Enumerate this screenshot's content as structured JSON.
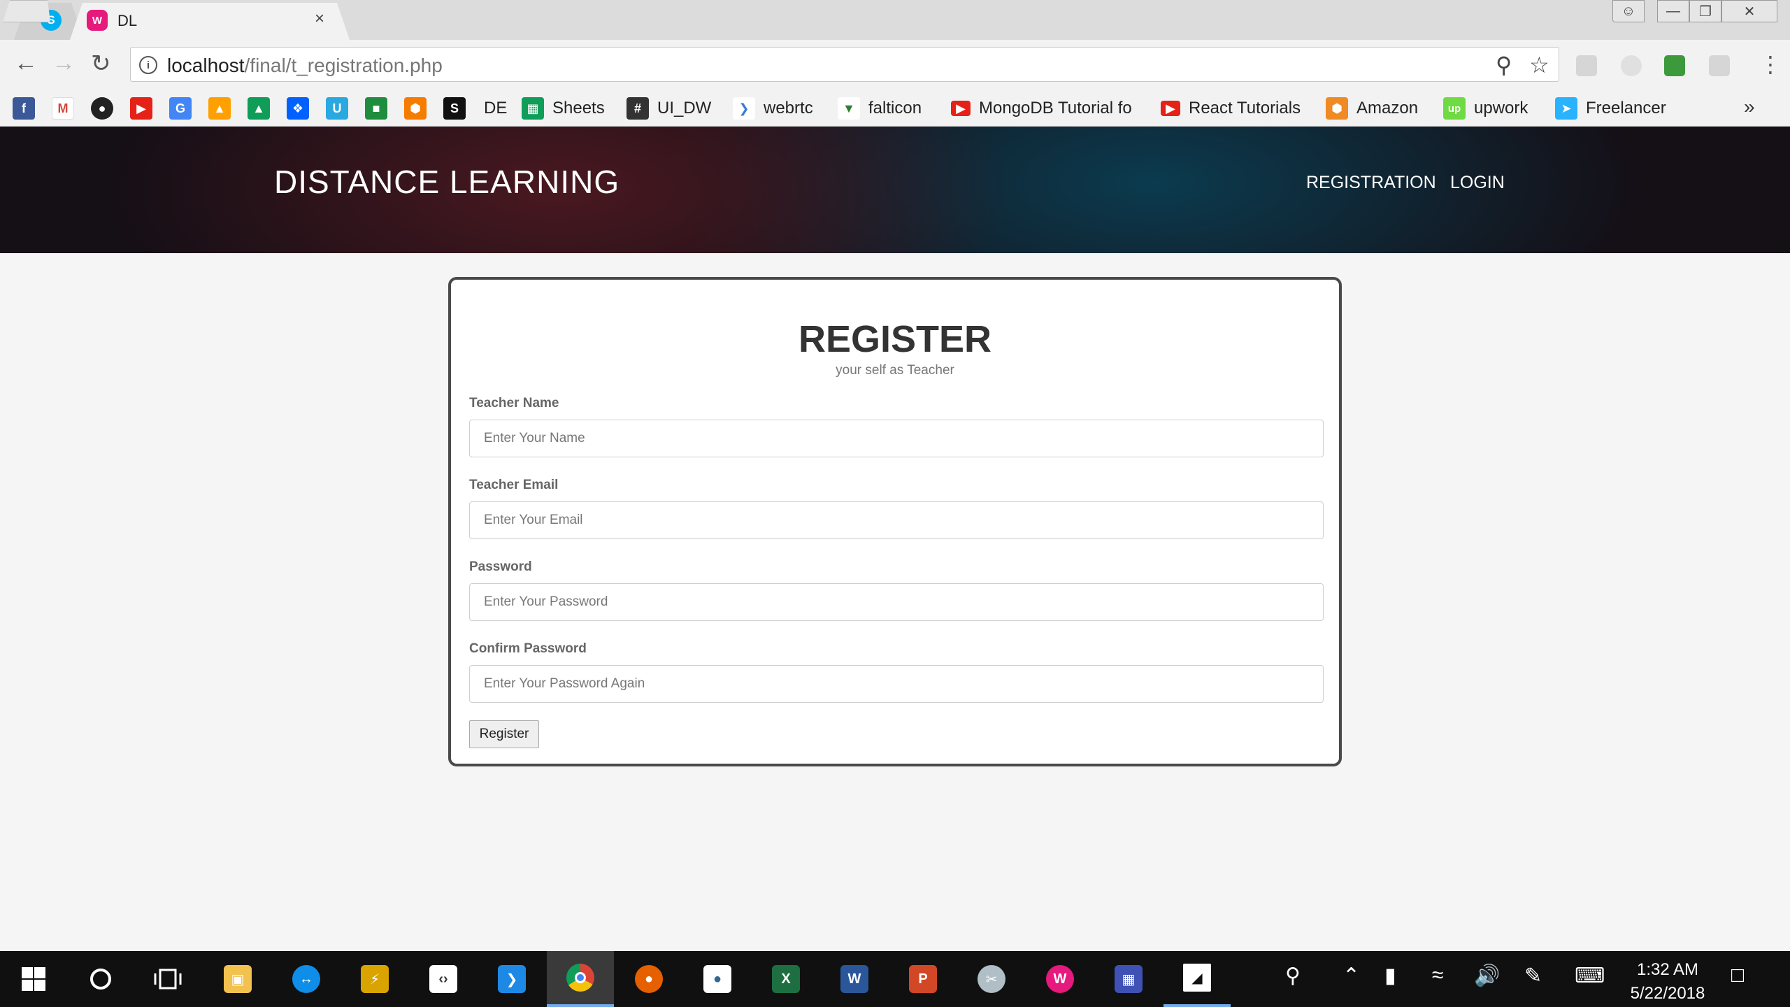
{
  "browser": {
    "tab_title": "DL",
    "tab_close": "×",
    "url_host": "localhost",
    "url_path": "/final/t_registration.php",
    "bookmarks": [
      "DE",
      "Sheets",
      "UI_DW",
      "webrtc",
      "falticon",
      "MongoDB Tutorial fo",
      "React Tutorials",
      "Amazon",
      "upwork",
      "Freelancer"
    ],
    "bookmarks_more": "»"
  },
  "site": {
    "brand": "DISTANCE LEARNING",
    "nav": {
      "registration": "REGISTRATION",
      "login": "LOGIN"
    }
  },
  "form": {
    "title": "REGISTER",
    "subtitle": "your self as Teacher",
    "fields": [
      {
        "label": "Teacher Name",
        "placeholder": "Enter Your Name",
        "value": ""
      },
      {
        "label": "Teacher Email",
        "placeholder": "Enter Your Email",
        "value": ""
      },
      {
        "label": "Password",
        "placeholder": "Enter Your Password",
        "value": ""
      },
      {
        "label": "Confirm Password",
        "placeholder": "Enter Your Password Again",
        "value": ""
      }
    ],
    "submit": "Register"
  },
  "taskbar": {
    "time": "1:32 AM",
    "date": "5/22/2018"
  },
  "icons": {
    "tabs": [
      "skype-icon",
      "wamp-icon"
    ],
    "toolbar": [
      "back-icon",
      "forward-icon",
      "reload-icon",
      "info-icon",
      "zoom-icon",
      "star-icon",
      "menu-icon"
    ],
    "taskbar": [
      "windows-icon",
      "cortana-icon",
      "task-view-icon",
      "file-explorer-icon",
      "teamviewer-icon",
      "chrome-icon",
      "vscode-icon",
      "excel-icon",
      "word-icon",
      "powerpoint-icon"
    ]
  },
  "colors": {
    "header_bg": "#150f16",
    "card_border": "#4a4a4a",
    "taskbar_accent": "#76a9ea"
  }
}
